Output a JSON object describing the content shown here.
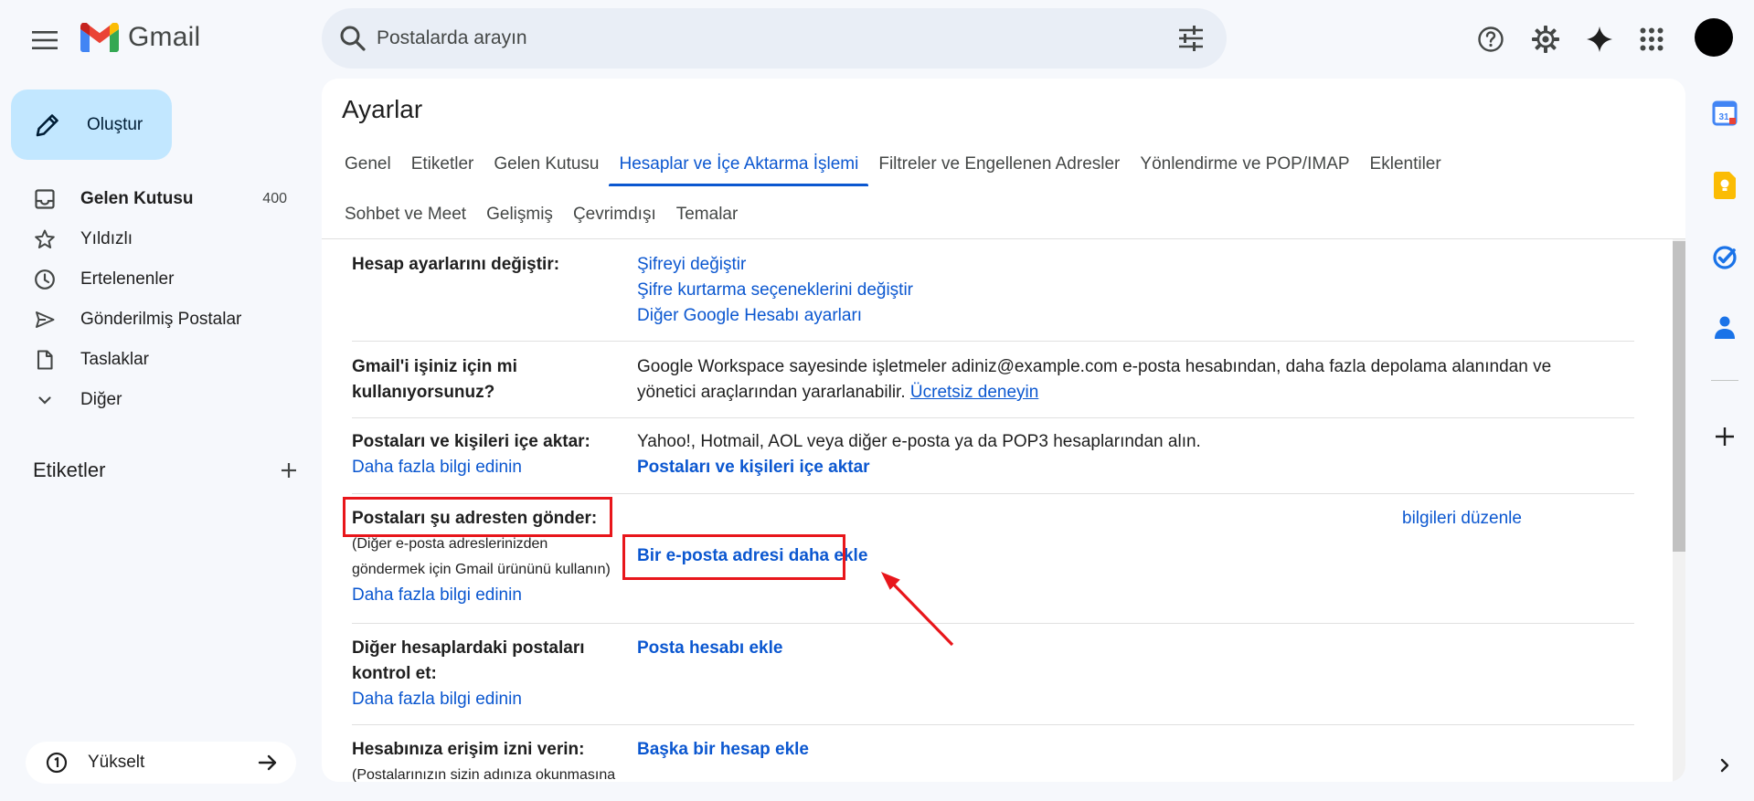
{
  "header": {
    "menu_icon": "menu-icon",
    "app_name": "Gmail",
    "search_placeholder": "Postalarda arayın",
    "icons": [
      "help-icon",
      "gear-icon",
      "sparkle-icon",
      "apps-icon"
    ]
  },
  "sidebar": {
    "compose_label": "Oluştur",
    "items": [
      {
        "label": "Gelen Kutusu",
        "count": "400",
        "icon": "inbox-icon"
      },
      {
        "label": "Yıldızlı",
        "icon": "star-icon"
      },
      {
        "label": "Ertelenenler",
        "icon": "clock-icon"
      },
      {
        "label": "Gönderilmiş Postalar",
        "icon": "send-icon"
      },
      {
        "label": "Taslaklar",
        "icon": "draft-icon"
      },
      {
        "label": "Diğer",
        "icon": "chevron-down-icon"
      }
    ],
    "labels_title": "Etiketler",
    "upgrade_label": "Yükselt"
  },
  "settings": {
    "title": "Ayarlar",
    "tabs_row1": [
      {
        "label": "Genel",
        "active": false
      },
      {
        "label": "Etiketler",
        "active": false
      },
      {
        "label": "Gelen Kutusu",
        "active": false
      },
      {
        "label": "Hesaplar ve İçe Aktarma İşlemi",
        "active": true
      },
      {
        "label": "Filtreler ve Engellenen Adresler",
        "active": false
      },
      {
        "label": "Yönlendirme ve POP/IMAP",
        "active": false
      },
      {
        "label": "Eklentiler",
        "active": false
      }
    ],
    "tabs_row2": [
      {
        "label": "Sohbet ve Meet",
        "active": false
      },
      {
        "label": "Gelişmiş",
        "active": false
      },
      {
        "label": "Çevrimdışı",
        "active": false
      },
      {
        "label": "Temalar",
        "active": false
      }
    ],
    "account": {
      "label": "Hesap ayarlarını değiştir:",
      "links": [
        "Şifreyi değiştir",
        "Şifre kurtarma seçeneklerini değiştir",
        "Diğer Google Hesabı ayarları"
      ]
    },
    "workspace": {
      "label": "Gmail'i işiniz için mi kullanıyorsunuz?",
      "text": "Google Workspace sayesinde işletmeler adiniz@example.com e-posta hesabından, daha fazla depolama alanından ve yönetici araçlarından yararlanabilir.",
      "link": "Ücretsiz deneyin"
    },
    "import": {
      "label": "Postaları ve kişileri içe aktar:",
      "learn_more": "Daha fazla bilgi edinin",
      "text": "Yahoo!, Hotmail, AOL veya diğer e-posta ya da POP3 hesaplarından alın.",
      "action": "Postaları ve kişileri içe aktar"
    },
    "send_as": {
      "label": "Postaları şu adresten gönder:",
      "sub1": "(Diğer e-posta adreslerinizden",
      "sub2": "göndermek için Gmail ürününü kullanın)",
      "learn_more": "Daha fazla bilgi edinin",
      "edit_link": "bilgileri düzenle",
      "action": "Bir e-posta adresi daha ekle"
    },
    "check_mail": {
      "label": "Diğer hesaplardaki postaları kontrol et:",
      "learn_more": "Daha fazla bilgi edinin",
      "action": "Posta hesabı ekle"
    },
    "grant_access": {
      "label": "Hesabınıza erişim izni verin:",
      "sub": "(Postalarınızın sizin adınıza okunmasına",
      "action": "Başka bir hesap ekle"
    }
  },
  "right_rail": {
    "icons": [
      "calendar-icon",
      "keep-icon",
      "tasks-icon",
      "contacts-icon",
      "plus-icon",
      "chevron-right-icon"
    ],
    "calendar_day": "31"
  },
  "colors": {
    "accent": "#0b57d0",
    "compose_bg": "#c2e7ff",
    "highlight": "#e8161b"
  }
}
